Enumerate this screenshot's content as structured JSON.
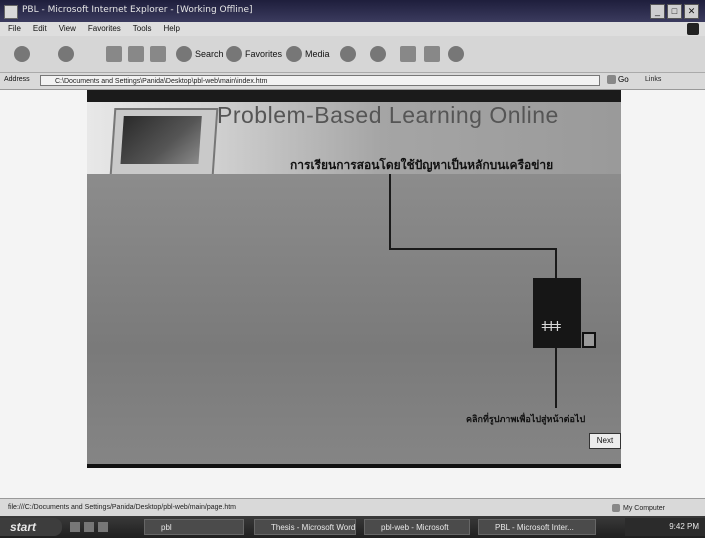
{
  "window": {
    "title": "PBL - Microsoft Internet Explorer - [Working Offline]",
    "minimize": "_",
    "maximize": "□",
    "close": "✕"
  },
  "menu": [
    "File",
    "Edit",
    "View",
    "Favorites",
    "Tools",
    "Help"
  ],
  "toolbar": {
    "search_label": "Search",
    "favorites_label": "Favorites",
    "media_label": "Media"
  },
  "address": {
    "label": "Address",
    "value": "C:\\Documents and Settings\\Panida\\Desktop\\pbl-web\\main\\index.htm",
    "go_label": "Go",
    "links_label": "Links"
  },
  "page": {
    "title": "Problem-Based Learning Online",
    "subtitle": "การเรียนการสอนโดยใช้ปัญหาเป็นหลักบนเครือข่าย",
    "bottom_link": "คลิกที่รูปภาพเพื่อไปสู่หน้าต่อไป",
    "next_button": "Next"
  },
  "status": {
    "text": "file:///C:/Documents and Settings/Panida/Desktop/pbl-web/main/page.htm",
    "zone": "My Computer"
  },
  "taskbar": {
    "start_label": "start",
    "tasks": [
      "pbl",
      "Thesis - Microsoft Word",
      "pbl-web - Microsoft",
      "PBL - Microsoft Inter..."
    ],
    "clock": "9:42 PM"
  },
  "colors": {
    "titlebar": "#2b2b4a",
    "page_background": "#8c8c8c",
    "accent_black": "#1b1b1b"
  }
}
